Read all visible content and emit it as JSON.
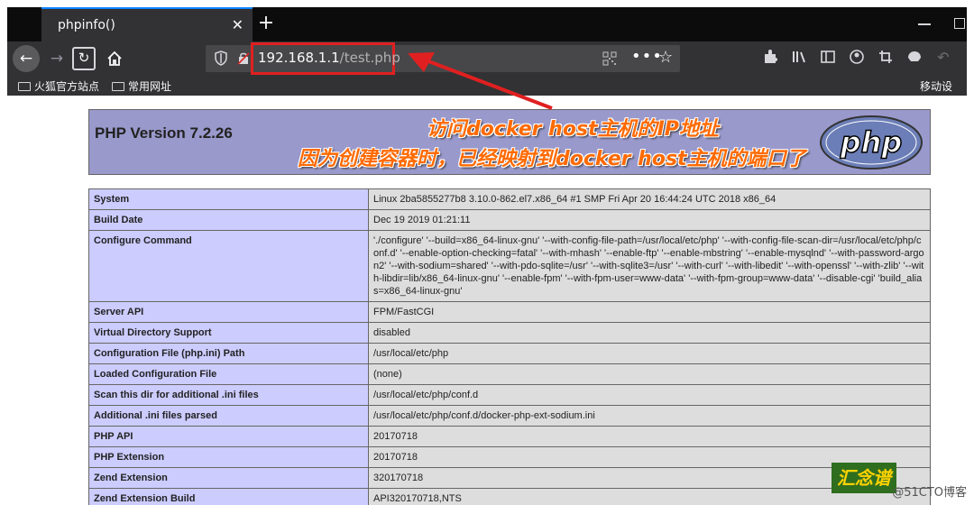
{
  "browser": {
    "tab_title": "phpinfo()",
    "tab_close": "✕",
    "new_tab": "+",
    "url_host": "192.168.1.1",
    "url_path": "/test.php",
    "url_menu": "•••",
    "url_star": "☆",
    "bookmarks": [
      {
        "label": "火狐官方站点"
      },
      {
        "label": "常用网址"
      }
    ],
    "bookmarks_right": "移动设"
  },
  "php": {
    "version": "PHP Version 7.2.26"
  },
  "annotations": {
    "line1": "访问docker host主机的IP地址",
    "line2": "因为创建容器时，已经映射到docker host主机的端口了"
  },
  "info_rows": [
    {
      "k": "System",
      "v": "Linux 2ba5855277b8 3.10.0-862.el7.x86_64 #1 SMP Fri Apr 20 16:44:24 UTC 2018 x86_64"
    },
    {
      "k": "Build Date",
      "v": "Dec 19 2019 01:21:11"
    },
    {
      "k": "Configure Command",
      "v": "'./configure' '--build=x86_64-linux-gnu' '--with-config-file-path=/usr/local/etc/php' '--with-config-file-scan-dir=/usr/local/etc/php/conf.d' '--enable-option-checking=fatal' '--with-mhash' '--enable-ftp' '--enable-mbstring' '--enable-mysqlnd' '--with-password-argon2' '--with-sodium=shared' '--with-pdo-sqlite=/usr' '--with-sqlite3=/usr' '--with-curl' '--with-libedit' '--with-openssl' '--with-zlib' '--with-libdir=lib/x86_64-linux-gnu' '--enable-fpm' '--with-fpm-user=www-data' '--with-fpm-group=www-data' '--disable-cgi' 'build_alias=x86_64-linux-gnu'"
    },
    {
      "k": "Server API",
      "v": "FPM/FastCGI"
    },
    {
      "k": "Virtual Directory Support",
      "v": "disabled"
    },
    {
      "k": "Configuration File (php.ini) Path",
      "v": "/usr/local/etc/php"
    },
    {
      "k": "Loaded Configuration File",
      "v": "(none)"
    },
    {
      "k": "Scan this dir for additional .ini files",
      "v": "/usr/local/etc/php/conf.d"
    },
    {
      "k": "Additional .ini files parsed",
      "v": "/usr/local/etc/php/conf.d/docker-php-ext-sodium.ini"
    },
    {
      "k": "PHP API",
      "v": "20170718"
    },
    {
      "k": "PHP Extension",
      "v": "20170718"
    },
    {
      "k": "Zend Extension",
      "v": "320170718"
    },
    {
      "k": "Zend Extension Build",
      "v": "API320170718,NTS"
    }
  ],
  "watermark": {
    "logo": "汇念谱",
    "text": "@51CTO博客"
  },
  "colors": {
    "annotation": "#ff6a00",
    "highlight_box": "#e02020",
    "php_header": "#9999cc",
    "key_cell": "#ccccff",
    "value_cell": "#dddddd"
  }
}
